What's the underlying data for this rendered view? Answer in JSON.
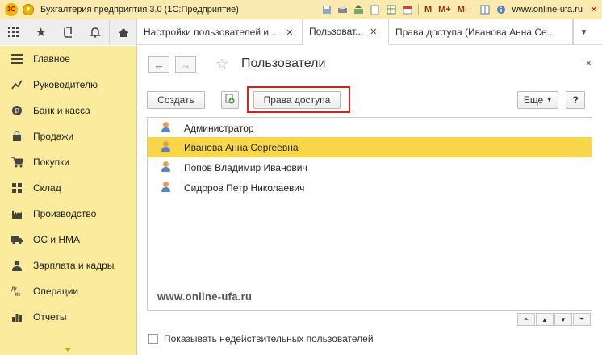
{
  "app": {
    "title": "Бухгалтерия предприятия 3.0   (1С:Предприятие)",
    "logo_text": "1С",
    "site": "www.online-ufa.ru",
    "memory_buttons": [
      "M",
      "M+",
      "M-"
    ]
  },
  "tabs": [
    {
      "label": "Настройки пользователей и ...",
      "active": false
    },
    {
      "label": "Пользоват...",
      "active": true
    },
    {
      "label": "Права доступа (Иванова Анна Се...",
      "active": false
    }
  ],
  "sidebar": {
    "items": [
      {
        "label": "Главное",
        "icon": "menu-icon"
      },
      {
        "label": "Руководителю",
        "icon": "chart-icon"
      },
      {
        "label": "Банк и касса",
        "icon": "coin-icon"
      },
      {
        "label": "Продажи",
        "icon": "bag-icon"
      },
      {
        "label": "Покупки",
        "icon": "cart-icon"
      },
      {
        "label": "Склад",
        "icon": "warehouse-icon"
      },
      {
        "label": "Производство",
        "icon": "factory-icon"
      },
      {
        "label": "ОС и НМА",
        "icon": "truck-icon"
      },
      {
        "label": "Зарплата и кадры",
        "icon": "person-icon"
      },
      {
        "label": "Операции",
        "icon": "dt-kt-icon"
      },
      {
        "label": "Отчеты",
        "icon": "report-icon"
      }
    ]
  },
  "page": {
    "title": "Пользователи",
    "close": "×"
  },
  "toolbar": {
    "create": "Создать",
    "access_rights": "Права доступа",
    "more": "Еще",
    "help": "?"
  },
  "users": [
    {
      "name": "Администратор",
      "selected": false
    },
    {
      "name": "Иванова Анна Сергеевна",
      "selected": true
    },
    {
      "name": "Попов Владимир Иванович",
      "selected": false
    },
    {
      "name": "Сидоров Петр Николаевич",
      "selected": false
    }
  ],
  "watermark": "www.online-ufa.ru",
  "show_invalid_label": "Показывать недействительных пользователей",
  "colors": {
    "sidebar_bg": "#fbeb9d",
    "selected_row": "#f9d649",
    "highlight_border": "#e01b1b"
  }
}
